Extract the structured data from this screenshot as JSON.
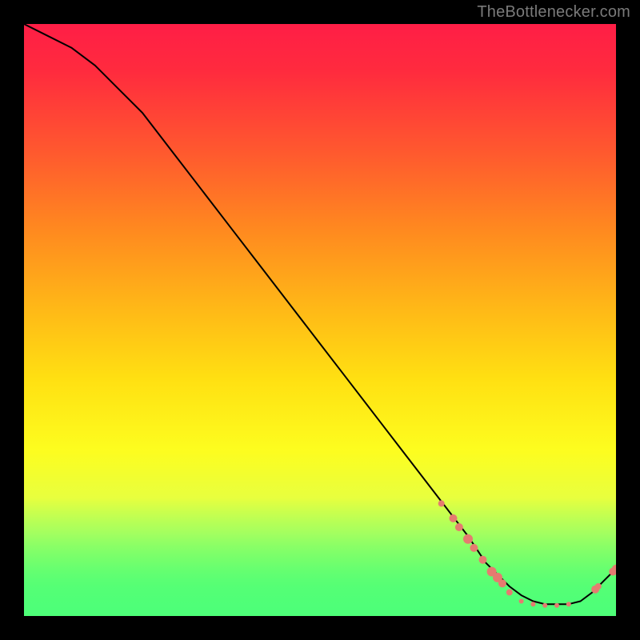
{
  "source_label": "TheBottlenecker.com",
  "chart_data": {
    "type": "line",
    "title": "",
    "xlabel": "",
    "ylabel": "",
    "xlim": [
      0,
      100
    ],
    "ylim": [
      0,
      100
    ],
    "series": [
      {
        "name": "bottleneck-curve",
        "x": [
          0,
          4,
          8,
          12,
          16,
          20,
          25,
          30,
          35,
          40,
          45,
          50,
          55,
          60,
          65,
          70,
          75,
          78,
          80,
          82,
          84,
          86,
          88,
          90,
          92,
          94,
          96,
          98,
          100
        ],
        "y": [
          100,
          98,
          96,
          93,
          89,
          85,
          78.5,
          72,
          65.5,
          59,
          52.5,
          46,
          39.5,
          33,
          26.5,
          20,
          13.5,
          9,
          7,
          5,
          3.5,
          2.5,
          2,
          2,
          2,
          2.5,
          4,
          6,
          8
        ],
        "color": "#000000"
      }
    ],
    "points": {
      "name": "data-points",
      "color": "#e57b70",
      "items": [
        {
          "x": 70.5,
          "y": 19,
          "r": 4
        },
        {
          "x": 72.5,
          "y": 16.5,
          "r": 5
        },
        {
          "x": 73.5,
          "y": 15,
          "r": 5
        },
        {
          "x": 75,
          "y": 13,
          "r": 6
        },
        {
          "x": 76,
          "y": 11.5,
          "r": 5
        },
        {
          "x": 77.5,
          "y": 9.5,
          "r": 5
        },
        {
          "x": 79,
          "y": 7.5,
          "r": 6
        },
        {
          "x": 80,
          "y": 6.5,
          "r": 6
        },
        {
          "x": 80.8,
          "y": 5.5,
          "r": 5
        },
        {
          "x": 82,
          "y": 4,
          "r": 4
        },
        {
          "x": 84,
          "y": 2.5,
          "r": 3
        },
        {
          "x": 86,
          "y": 2,
          "r": 3
        },
        {
          "x": 88,
          "y": 1.8,
          "r": 3
        },
        {
          "x": 90,
          "y": 1.8,
          "r": 3
        },
        {
          "x": 92,
          "y": 2,
          "r": 3
        },
        {
          "x": 96.5,
          "y": 4.5,
          "r": 5
        },
        {
          "x": 97,
          "y": 5,
          "r": 4
        },
        {
          "x": 99.5,
          "y": 7.5,
          "r": 5
        },
        {
          "x": 100,
          "y": 8,
          "r": 5
        }
      ]
    }
  }
}
